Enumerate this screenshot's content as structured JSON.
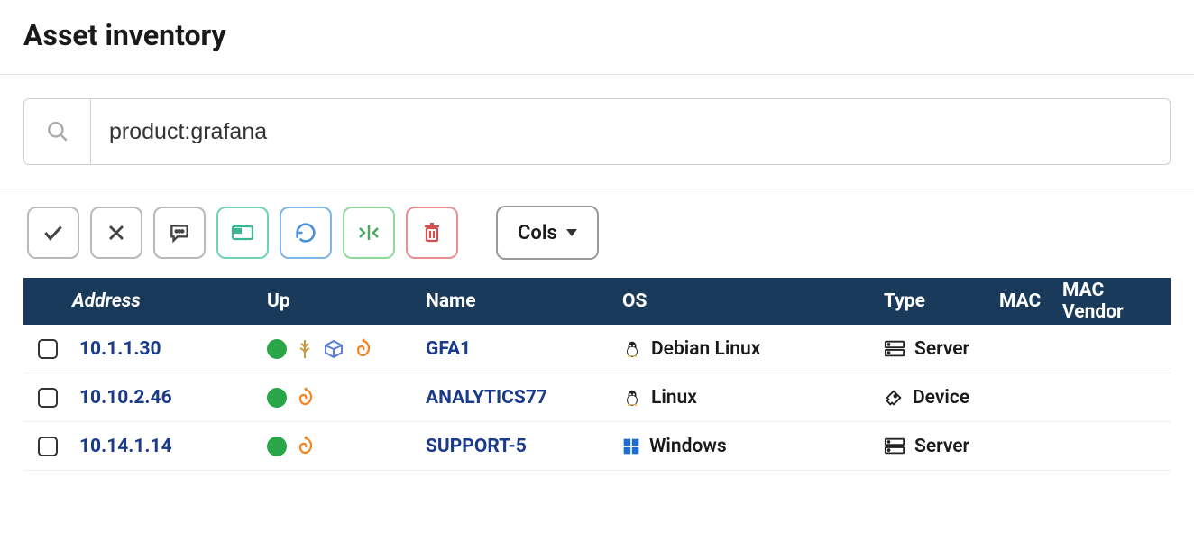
{
  "page": {
    "title": "Asset inventory"
  },
  "search": {
    "value": "product:grafana"
  },
  "toolbar": {
    "approve": "check",
    "reject": "x",
    "comment": "comment",
    "screen": "screen",
    "history": "history",
    "merge": "merge",
    "delete": "delete",
    "cols_label": "Cols"
  },
  "table": {
    "headers": {
      "address": "Address",
      "up": "Up",
      "name": "Name",
      "os": "OS",
      "type": "Type",
      "mac": "MAC",
      "mac_vendor": "MAC Vendor"
    },
    "rows": [
      {
        "address": "10.1.1.30",
        "up": true,
        "icons": [
          "wheat",
          "cube",
          "grafana"
        ],
        "name": "GFA1",
        "os": "Debian Linux",
        "os_icon": "linux",
        "type": "Server",
        "type_icon": "server"
      },
      {
        "address": "10.10.2.46",
        "up": true,
        "icons": [
          "grafana"
        ],
        "name": "ANALYTICS77",
        "os": "Linux",
        "os_icon": "linux",
        "type": "Device",
        "type_icon": "device"
      },
      {
        "address": "10.14.1.14",
        "up": true,
        "icons": [
          "grafana"
        ],
        "name": "SUPPORT-5",
        "os": "Windows",
        "os_icon": "windows",
        "type": "Server",
        "type_icon": "server"
      }
    ]
  }
}
